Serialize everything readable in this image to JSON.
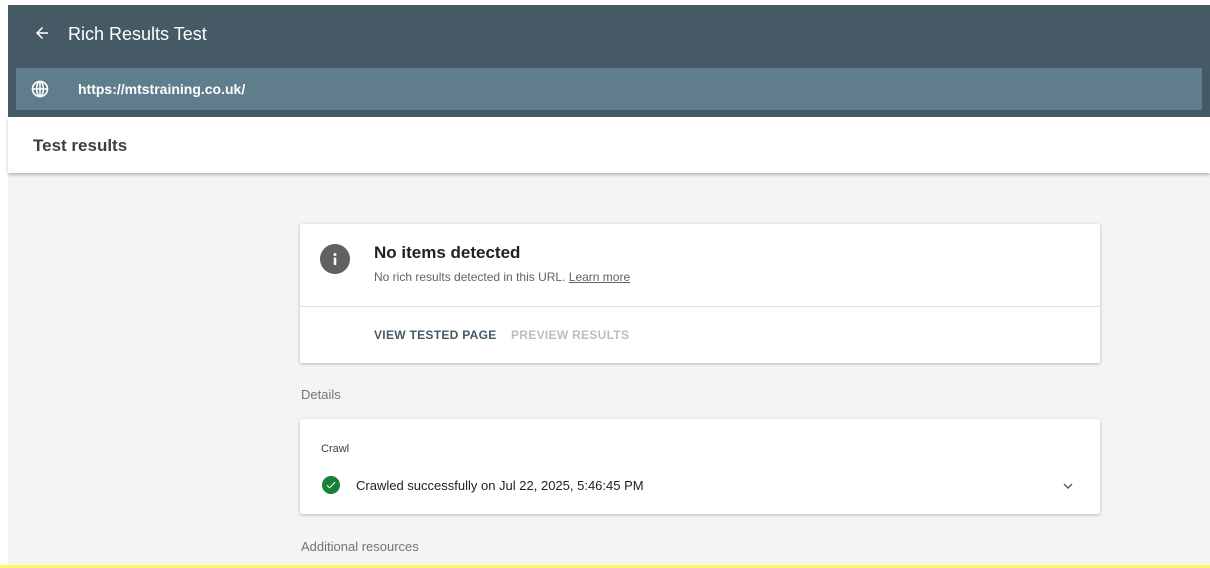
{
  "header": {
    "app_title": "Rich Results Test",
    "url": "https://mtstraining.co.uk/",
    "back_icon": "arrow-back-icon",
    "globe_icon": "globe-icon"
  },
  "subheader": {
    "title": "Test results"
  },
  "result_card": {
    "icon": "info-icon",
    "title": "No items detected",
    "message": "No rich results detected in this URL.",
    "link": "Learn more",
    "tabs": [
      {
        "label": "VIEW TESTED PAGE",
        "state": "active"
      },
      {
        "label": "PREVIEW RESULTS",
        "state": "disabled"
      }
    ]
  },
  "details": {
    "label": "Details",
    "crawl": {
      "title": "Crawl",
      "icon": "check-circle-icon",
      "status": "Crawled successfully on Jul 22, 2025, 5:46:45 PM",
      "expand_icon": "chevron-down-icon"
    }
  },
  "additional": {
    "label": "Additional resources"
  },
  "colors": {
    "header_bg": "#455a64",
    "urlbar_bg": "#607d8b",
    "success": "#188038",
    "accent_line": "#fff95c"
  }
}
